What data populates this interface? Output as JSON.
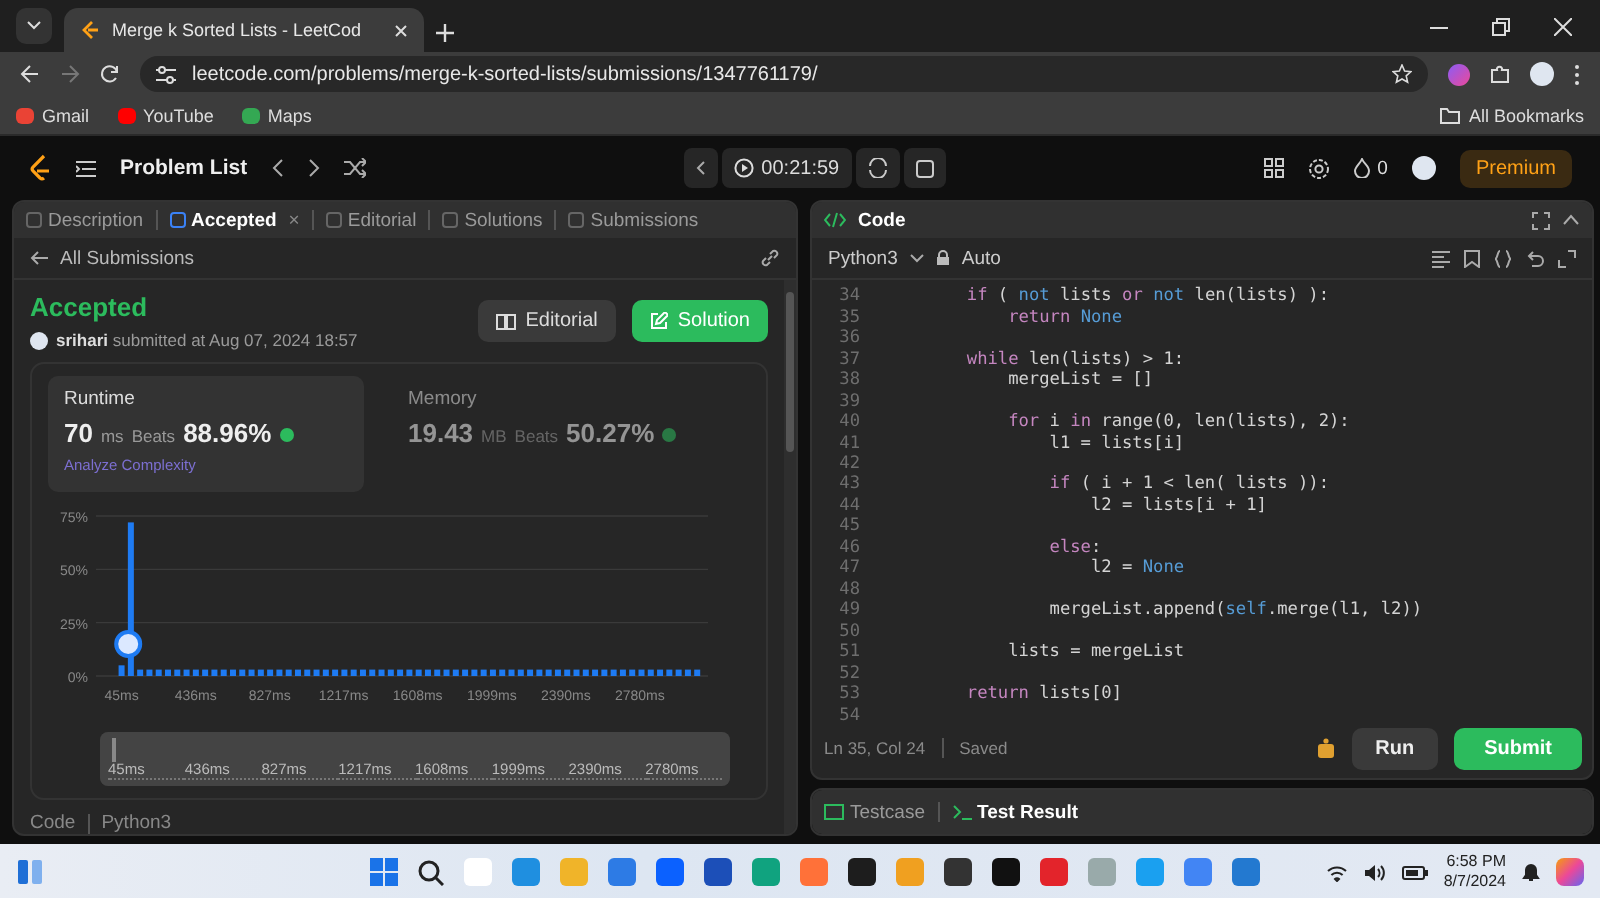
{
  "browser": {
    "tab_title": "Merge k Sorted Lists - LeetCod",
    "url": "leetcode.com/problems/merge-k-sorted-lists/submissions/1347761179/",
    "bookmarks": [
      "Gmail",
      "YouTube",
      "Maps"
    ],
    "all_bookmarks": "All Bookmarks"
  },
  "topbar": {
    "problem_list": "Problem List",
    "timer": "00:21:59",
    "streak": "0",
    "premium": "Premium"
  },
  "left_tabs": [
    {
      "label": "Description",
      "selected": false
    },
    {
      "label": "Accepted",
      "selected": true,
      "close": "×"
    },
    {
      "label": "Editorial",
      "selected": false
    },
    {
      "label": "Solutions",
      "selected": false
    },
    {
      "label": "Submissions",
      "selected": false
    }
  ],
  "back_link": "All Submissions",
  "submission": {
    "status": "Accepted",
    "byline": "**srihari** submitted at Aug 07, 2024 18:57",
    "buttons": [
      {
        "label": "Editorial",
        "kind": "secondary"
      },
      {
        "label": "Solution",
        "kind": "primary"
      }
    ]
  },
  "metrics": [
    {
      "title": "Runtime",
      "value": "70",
      "unit": "ms",
      "beats_label": "Beats",
      "beats": "88.96%",
      "selected": true,
      "link": "Analyze Complexity"
    },
    {
      "title": "Memory",
      "value": "19.43",
      "unit": "MB",
      "beats_label": "Beats",
      "beats": "50.27%",
      "selected": false
    }
  ],
  "chart_data": {
    "type": "bar",
    "x": [
      45,
      94,
      143,
      192,
      241,
      290,
      339,
      388,
      437,
      486,
      535,
      584,
      633,
      682,
      731,
      780,
      829,
      878,
      927,
      976,
      1025,
      1074,
      1123,
      1172,
      1221,
      1270,
      1319,
      1368,
      1417,
      1466,
      1515,
      1564,
      1613,
      1662,
      1711,
      1760,
      1809,
      1858,
      1907,
      1956,
      2005,
      2054,
      2103,
      2152,
      2201,
      2250,
      2299,
      2348,
      2397,
      2446,
      2495,
      2544,
      2593,
      2642,
      2691,
      2740,
      2789,
      2838,
      2887,
      2936,
      2985,
      3034,
      3083
    ],
    "values": [
      5,
      72,
      3,
      3,
      3,
      3,
      3,
      3,
      3,
      3,
      3,
      3,
      3,
      3,
      3,
      3,
      3,
      3,
      3,
      3,
      3,
      3,
      3,
      3,
      3,
      3,
      3,
      3,
      3,
      3,
      3,
      3,
      3,
      3,
      3,
      3,
      3,
      3,
      3,
      3,
      3,
      3,
      3,
      3,
      3,
      3,
      3,
      3,
      3,
      3,
      3,
      3,
      3,
      3,
      3,
      3,
      3,
      3,
      3,
      3,
      3,
      3,
      3
    ],
    "xlim": [
      -90,
      3140
    ],
    "ylim": [
      0,
      75
    ],
    "grid": true,
    "xticks": [
      {
        "value": 45,
        "label": "45ms"
      },
      {
        "value": 436,
        "label": "436ms"
      },
      {
        "value": 827,
        "label": "827ms"
      },
      {
        "value": 1217,
        "label": "1217ms"
      },
      {
        "value": 1608,
        "label": "1608ms"
      },
      {
        "value": 1999,
        "label": "1999ms"
      },
      {
        "value": 2390,
        "label": "2390ms"
      },
      {
        "value": 2780,
        "label": "2780ms"
      }
    ],
    "yticks": [
      {
        "value": 0,
        "label": "0%"
      },
      {
        "value": 25,
        "label": "25%"
      },
      {
        "value": 50,
        "label": "50%"
      },
      {
        "value": 75,
        "label": "75%"
      }
    ]
  },
  "range_slider": {
    "level": 1
  },
  "range_labels": [
    "45ms",
    "436ms",
    "827ms",
    "1217ms",
    "1608ms",
    "1999ms",
    "2390ms",
    "2780ms"
  ],
  "code_section": {
    "title": "Code",
    "language": "Python3"
  },
  "editor": {
    "title": "Code",
    "language": "Python3",
    "mode": "Auto",
    "lines": [
      {
        "number": "34",
        "tokens": [
          {
            "text": "        if",
            "kind": "kw"
          },
          {
            "text": " ( ",
            "kind": "plain"
          },
          {
            "text": "not",
            "kind": "const"
          },
          {
            "text": " lists ",
            "kind": "plain"
          },
          {
            "text": "or",
            "kind": "kw"
          },
          {
            "text": " not",
            "kind": "const"
          },
          {
            "text": " len(lists) ):",
            "kind": "plain"
          }
        ]
      },
      {
        "number": "35",
        "tokens": [
          {
            "text": "            return",
            "kind": "kw"
          },
          {
            "text": " None",
            "kind": "const"
          }
        ]
      },
      {
        "number": "36"
      },
      {
        "number": "37",
        "tokens": [
          {
            "text": "        while",
            "kind": "kw"
          },
          {
            "text": " len(lists) > 1:",
            "kind": "plain"
          }
        ]
      },
      {
        "number": "38",
        "tokens": [
          {
            "text": "            mergeList = []",
            "kind": "plain"
          }
        ]
      },
      {
        "number": "39"
      },
      {
        "number": "40",
        "tokens": [
          {
            "text": "            for",
            "kind": "kw"
          },
          {
            "text": " i ",
            "kind": "plain"
          },
          {
            "text": "in",
            "kind": "kw"
          },
          {
            "text": " range(0, len(lists), 2):",
            "kind": "plain"
          }
        ]
      },
      {
        "number": "41",
        "tokens": [
          {
            "text": "                l1 = lists[i]",
            "kind": "plain"
          }
        ]
      },
      {
        "number": "42"
      },
      {
        "number": "43",
        "tokens": [
          {
            "text": "                if",
            "kind": "kw"
          },
          {
            "text": " ( i + 1 < len( lists )):",
            "kind": "plain"
          }
        ]
      },
      {
        "number": "44",
        "tokens": [
          {
            "text": "                    l2 = lists[i + 1]",
            "kind": "plain"
          }
        ]
      },
      {
        "number": "45"
      },
      {
        "number": "46",
        "tokens": [
          {
            "text": "                else",
            "kind": "kw"
          },
          {
            "text": ":",
            "kind": "plain"
          }
        ]
      },
      {
        "number": "47",
        "tokens": [
          {
            "text": "                    l2 = ",
            "kind": "plain"
          },
          {
            "text": "None",
            "kind": "const"
          }
        ]
      },
      {
        "number": "48"
      },
      {
        "number": "49",
        "tokens": [
          {
            "text": "                mergeList.append(",
            "kind": "plain"
          },
          {
            "text": "self",
            "kind": "const"
          },
          {
            "text": ".merge(l1, l2))",
            "kind": "plain"
          }
        ]
      },
      {
        "number": "50"
      },
      {
        "number": "51",
        "tokens": [
          {
            "text": "            lists = mergeList",
            "kind": "plain"
          }
        ]
      },
      {
        "number": "52"
      },
      {
        "number": "53",
        "tokens": [
          {
            "text": "        return",
            "kind": "kw"
          },
          {
            "text": " lists[0]",
            "kind": "plain"
          }
        ]
      },
      {
        "number": "54"
      }
    ],
    "cursor": "Ln 35, Col 24",
    "status": "Saved",
    "run": "Run",
    "submit": "Submit"
  },
  "bottom_tabs": [
    {
      "label": "Testcase",
      "selected": false
    },
    {
      "label": "Test Result",
      "selected": true
    }
  ],
  "taskbar": {
    "time": "6:58 PM",
    "date": "8/7/2024"
  }
}
